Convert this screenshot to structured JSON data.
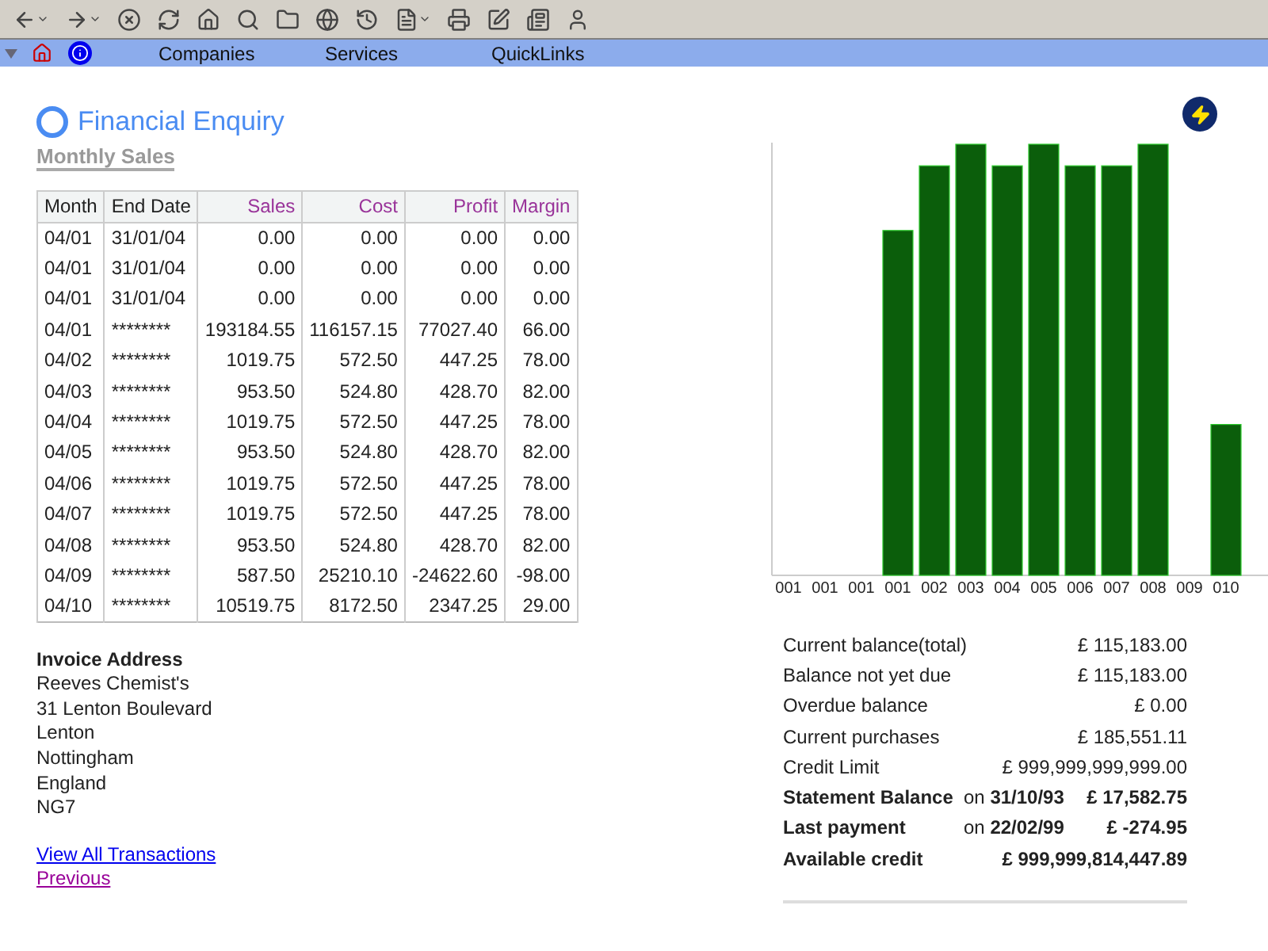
{
  "nav": {
    "items": [
      "Companies",
      "Services",
      "QuickLinks"
    ]
  },
  "heading": {
    "title": "Financial Enquiry",
    "subtitle": "Monthly Sales"
  },
  "table": {
    "columns": [
      "Month",
      "End Date",
      "Sales",
      "Cost",
      "Profit",
      "Margin"
    ],
    "rows": [
      [
        "04/01",
        "31/01/04",
        "0.00",
        "0.00",
        "0.00",
        "0.00"
      ],
      [
        "04/01",
        "31/01/04",
        "0.00",
        "0.00",
        "0.00",
        "0.00"
      ],
      [
        "04/01",
        "31/01/04",
        "0.00",
        "0.00",
        "0.00",
        "0.00"
      ],
      [
        "04/01",
        "********",
        "193184.55",
        "116157.15",
        "77027.40",
        "66.00"
      ],
      [
        "04/02",
        "********",
        "1019.75",
        "572.50",
        "447.25",
        "78.00"
      ],
      [
        "04/03",
        "********",
        "953.50",
        "524.80",
        "428.70",
        "82.00"
      ],
      [
        "04/04",
        "********",
        "1019.75",
        "572.50",
        "447.25",
        "78.00"
      ],
      [
        "04/05",
        "********",
        "953.50",
        "524.80",
        "428.70",
        "82.00"
      ],
      [
        "04/06",
        "********",
        "1019.75",
        "572.50",
        "447.25",
        "78.00"
      ],
      [
        "04/07",
        "********",
        "1019.75",
        "572.50",
        "447.25",
        "78.00"
      ],
      [
        "04/08",
        "********",
        "953.50",
        "524.80",
        "428.70",
        "82.00"
      ],
      [
        "04/09",
        "********",
        "587.50",
        "25210.10",
        "-24622.60",
        "-98.00"
      ],
      [
        "04/10",
        "********",
        "10519.75",
        "8172.50",
        "2347.25",
        "29.00"
      ]
    ]
  },
  "address": {
    "title": "Invoice Address",
    "lines": [
      "Reeves Chemist's",
      "31 Lenton Boulevard",
      "Lenton",
      "Nottingham",
      "England",
      "NG7"
    ]
  },
  "links": [
    {
      "label": "View All Transactions",
      "visited": false
    },
    {
      "label": "Previous",
      "visited": true
    }
  ],
  "chart": {
    "labels": [
      "001",
      "001",
      "001",
      "001",
      "002",
      "003",
      "004",
      "005",
      "006",
      "007",
      "008",
      "009",
      "010"
    ]
  },
  "balances": [
    {
      "label": "Current balance(total)",
      "amount": "£ 115,183.00",
      "bold": false
    },
    {
      "label": "Balance not yet due",
      "amount": "£ 115,183.00",
      "bold": false
    },
    {
      "label": "Overdue balance",
      "amount": "£ 0.00",
      "bold": false
    },
    {
      "label": "Current purchases",
      "amount": "£ 185,551.11",
      "bold": false
    },
    {
      "label": "Credit Limit",
      "amount": "£ 999,999,999,999.00",
      "bold": false
    },
    {
      "label": "Statement Balance",
      "note": "on **31/10/93**",
      "amount": "£ 17,582.75",
      "bold": true
    },
    {
      "label": "Last payment",
      "note": "on **22/02/99**",
      "amount": "£ -274.95",
      "bold": true
    },
    {
      "label": "Available credit",
      "amount": "£ 999,999,814,447.89",
      "bold": true
    }
  ]
}
